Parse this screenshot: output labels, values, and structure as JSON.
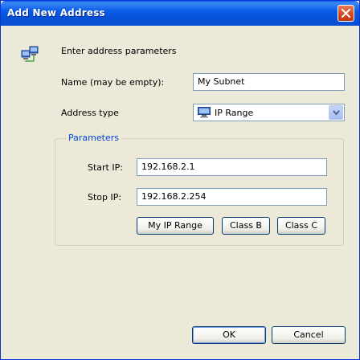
{
  "window": {
    "title": "Add New Address"
  },
  "header": {
    "text": "Enter address parameters",
    "icon": "network-computers-icon"
  },
  "name_field": {
    "label": "Name (may be empty):",
    "value": "My Subnet"
  },
  "address_type": {
    "label": "Address type",
    "selected": "IP Range",
    "icon": "ip-range-icon"
  },
  "parameters": {
    "title": "Parameters",
    "start_ip_label": "Start IP:",
    "start_ip_value": "192.168.2.1",
    "stop_ip_label": "Stop IP:",
    "stop_ip_value": "192.168.2.254",
    "buttons": {
      "my_ip_range": "My IP Range",
      "class_b": "Class B",
      "class_c": "Class C"
    }
  },
  "footer": {
    "ok_label": "OK",
    "cancel_label": "Cancel"
  },
  "colors": {
    "titlebar": "#0a5ce8",
    "dialog_bg": "#ece9d8",
    "group_title": "#0046d5",
    "close_button": "#d2451f"
  }
}
